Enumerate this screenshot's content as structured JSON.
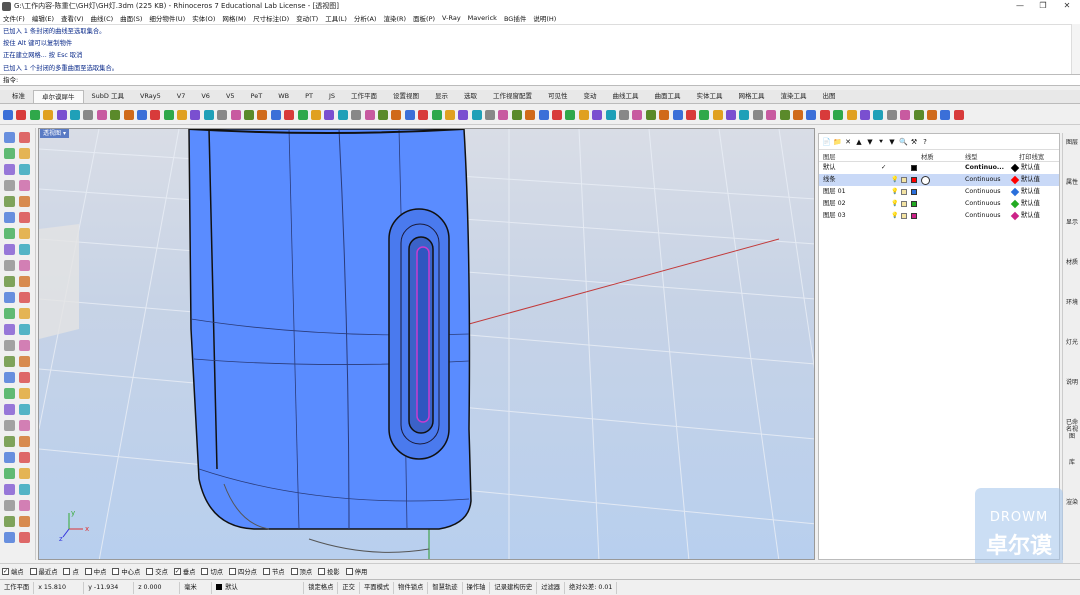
{
  "window": {
    "title": "G:\\工作内容-陈重仁\\GH灯\\GH灯.3dm (225 KB) - Rhinoceros 7 Educational Lab License - [透视图]",
    "controls": [
      "—",
      "❐",
      "✕"
    ]
  },
  "menu": [
    "文件(F)",
    "编辑(E)",
    "查看(V)",
    "曲线(C)",
    "曲面(S)",
    "细分物件(U)",
    "实体(O)",
    "网格(M)",
    "尺寸标注(D)",
    "变动(T)",
    "工具(L)",
    "分析(A)",
    "渲染(R)",
    "面板(P)",
    "V-Ray",
    "Maverick",
    "BG插件",
    "说明(H)"
  ],
  "command_history": [
    "已加入 1 条封闭的曲线至选取集合。",
    "按住 Alt 键可以复制物件",
    "正在建立网格... 按 Esc 取消",
    "已加入 1 个封闭的多重曲面至选取集合。"
  ],
  "command_prompt": "指令:",
  "tabs": [
    "标准",
    "卓尔谟犀牛",
    "SubD 工具",
    "VRay5",
    "V7",
    "V6",
    "V5",
    "PeT",
    "WB",
    "PT",
    "JS",
    "工作平面",
    "设置视图",
    "显示",
    "选取",
    "工作视窗配置",
    "可见性",
    "变动",
    "曲线工具",
    "曲面工具",
    "实体工具",
    "网格工具",
    "渲染工具",
    "出图"
  ],
  "active_tab": "卓尔谟犀牛",
  "toolbar_icon_count": 72,
  "viewport": {
    "label": "透视图",
    "label_arrow": "▾"
  },
  "axes": {
    "x": "x",
    "y": "y",
    "z": "z"
  },
  "layers": {
    "toolbar_icons": [
      "📄",
      "📁",
      "✕",
      "▲",
      "▼",
      "⯆",
      "▼",
      "🔍",
      "⚒",
      "?"
    ],
    "headers": {
      "name": "图层",
      "material": "材质",
      "linetype": "线型",
      "print_color": "打印线宽"
    },
    "rows": [
      {
        "name": "默认",
        "current": "✓",
        "color": "#000000",
        "linetype": "Continuo...",
        "print_color": "#000000",
        "print_width": "默认值",
        "selected": false
      },
      {
        "name": "线条",
        "current": "",
        "color": "#ff0000",
        "linetype": "Continuous",
        "print_color": "#ff0000",
        "print_width": "默认值",
        "selected": true
      },
      {
        "name": "图层 01",
        "current": "",
        "color": "#2a6fdb",
        "linetype": "Continuous",
        "print_color": "#2a6fdb",
        "print_width": "默认值",
        "selected": false
      },
      {
        "name": "图层 02",
        "current": "",
        "color": "#22aa22",
        "linetype": "Continuous",
        "print_color": "#22aa22",
        "print_width": "默认值",
        "selected": false
      },
      {
        "name": "图层 03",
        "current": "",
        "color": "#cc2288",
        "linetype": "Continuous",
        "print_color": "#cc2288",
        "print_width": "默认值",
        "selected": false
      }
    ]
  },
  "side_tabs": [
    "图层",
    "属性",
    "显示",
    "材质",
    "环境",
    "灯光",
    "说明",
    "已命名视图",
    "库",
    "渲染"
  ],
  "osnaps": [
    {
      "label": "端点",
      "checked": true
    },
    {
      "label": "最近点",
      "checked": false
    },
    {
      "label": "点",
      "checked": false
    },
    {
      "label": "中点",
      "checked": false
    },
    {
      "label": "中心点",
      "checked": false
    },
    {
      "label": "交点",
      "checked": false
    },
    {
      "label": "垂点",
      "checked": true
    },
    {
      "label": "切点",
      "checked": false
    },
    {
      "label": "四分点",
      "checked": false
    },
    {
      "label": "节点",
      "checked": false
    },
    {
      "label": "顶点",
      "checked": false
    },
    {
      "label": "投影",
      "checked": false
    },
    {
      "label": "停用",
      "checked": false
    }
  ],
  "status": {
    "cplane": "工作平面",
    "x": "x 15.810",
    "y": "y -11.934",
    "z": "z 0.000",
    "unit": "毫米",
    "layer": "默认",
    "items": [
      "锁定格点",
      "正交",
      "平面模式",
      "物件锁点",
      "智慧轨迹",
      "操作轴",
      "记录建构历史",
      "过滤器",
      "绝对公差: 0.01"
    ]
  },
  "watermark": {
    "line1": "DROWM",
    "line2": "卓尔谟"
  }
}
